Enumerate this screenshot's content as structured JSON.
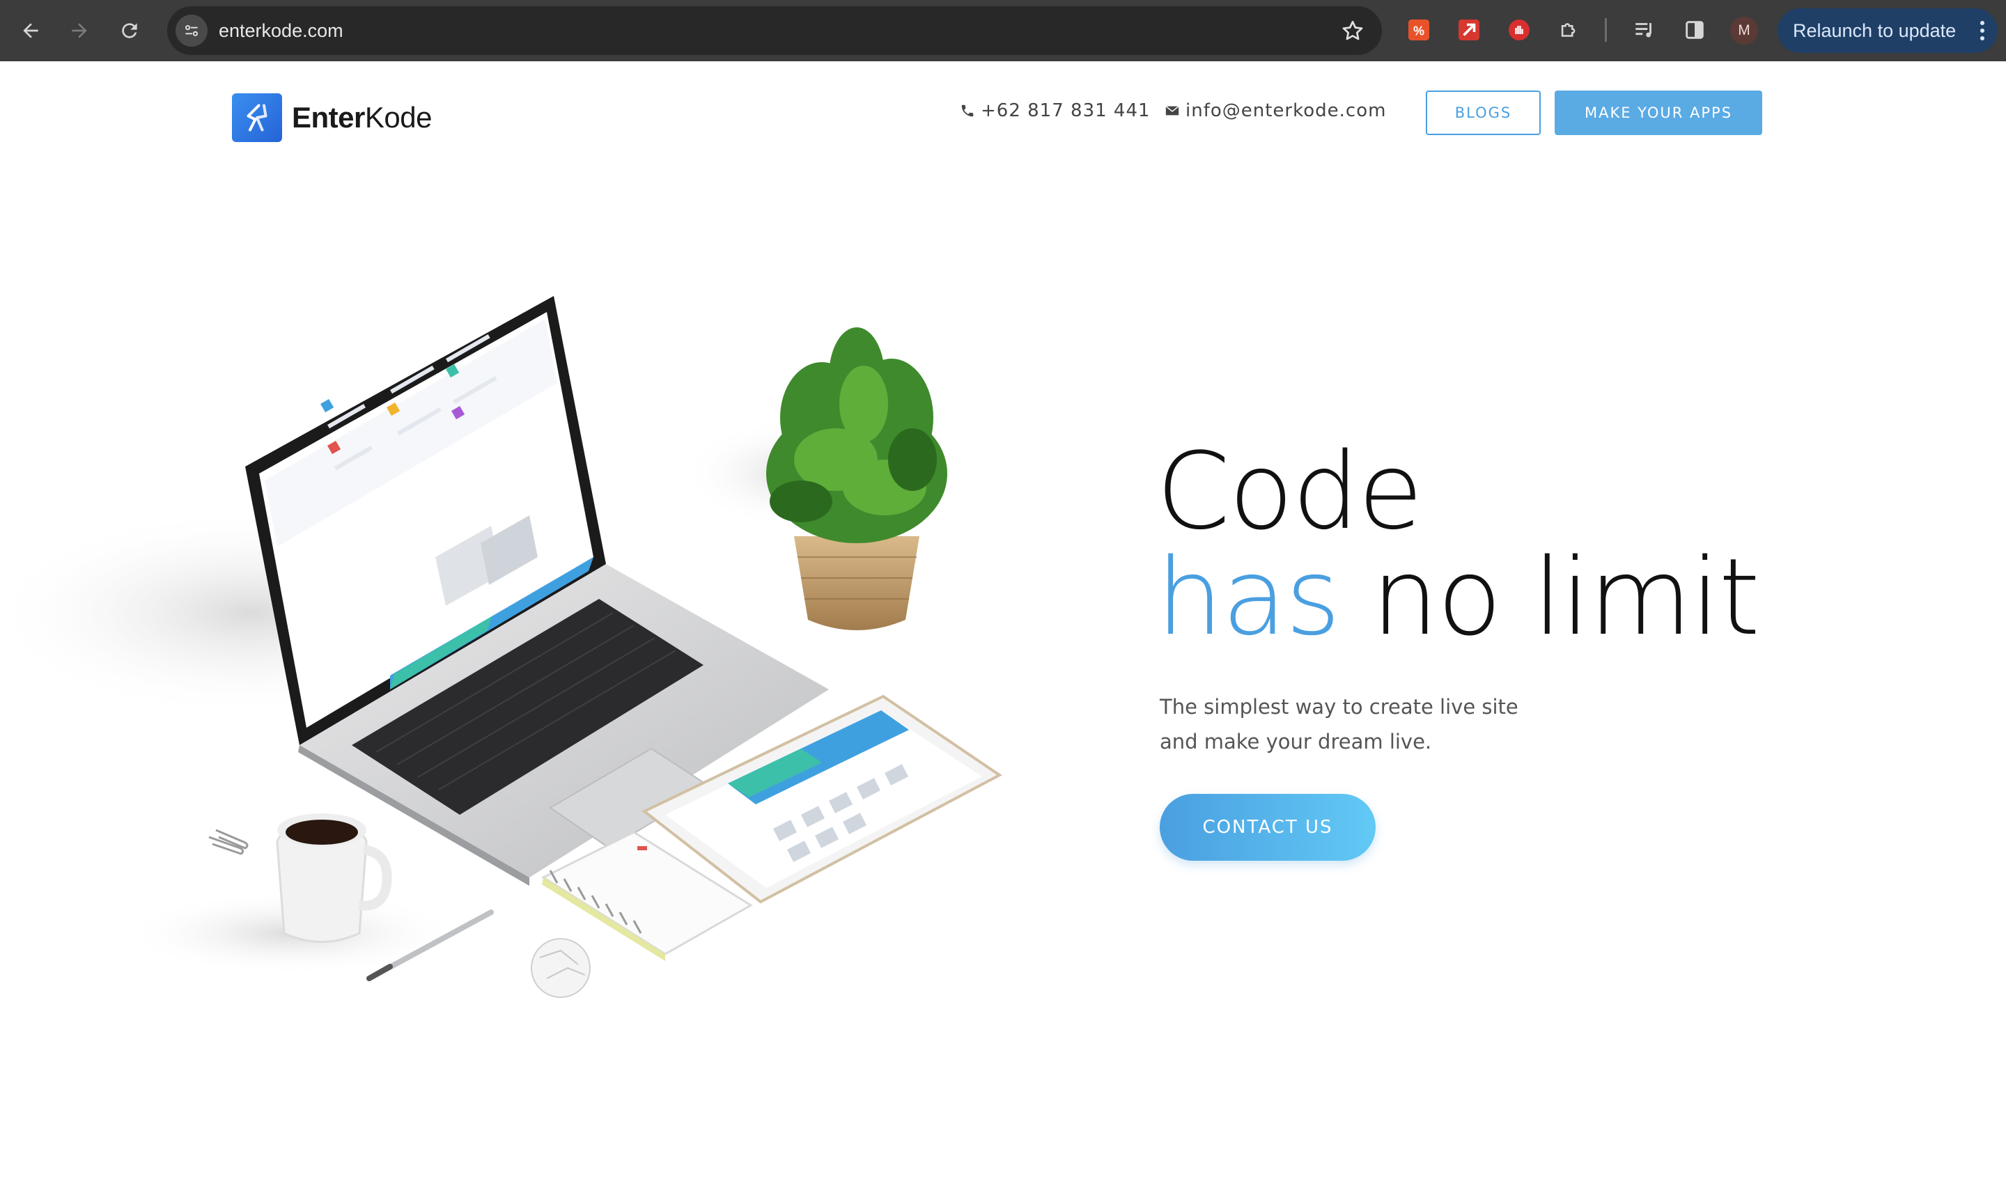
{
  "browser": {
    "url": "enterkode.com",
    "profile_initial": "M",
    "relaunch_label": "Relaunch to update"
  },
  "header": {
    "logo_strong": "Enter",
    "logo_light": "Kode",
    "phone": "+62 817 831 441",
    "email": "info@enterkode.com",
    "blogs_label": "BLOGS",
    "apps_label": "MAKE YOUR APPS"
  },
  "hero": {
    "title_line1": "Code",
    "title_accent": "has",
    "title_rest": " no limit",
    "subtitle_line1": "The simplest way to create live site",
    "subtitle_line2": "and make your dream live.",
    "cta_label": "CONTACT US"
  },
  "colors": {
    "accent": "#4a9fe0",
    "accent_light": "#62c9f5",
    "chrome_bar": "#3c3c3c",
    "relaunch_bg": "#1f3f66"
  },
  "icons": [
    "back-arrow-icon",
    "forward-arrow-icon",
    "reload-icon",
    "site-settings-icon",
    "star-icon",
    "translate-extension-icon",
    "arrow-extension-icon",
    "hand-extension-icon",
    "puzzle-extensions-icon",
    "media-queue-icon",
    "side-panel-icon",
    "more-vert-icon",
    "phone-icon",
    "envelope-icon",
    "logo-mark-icon"
  ]
}
